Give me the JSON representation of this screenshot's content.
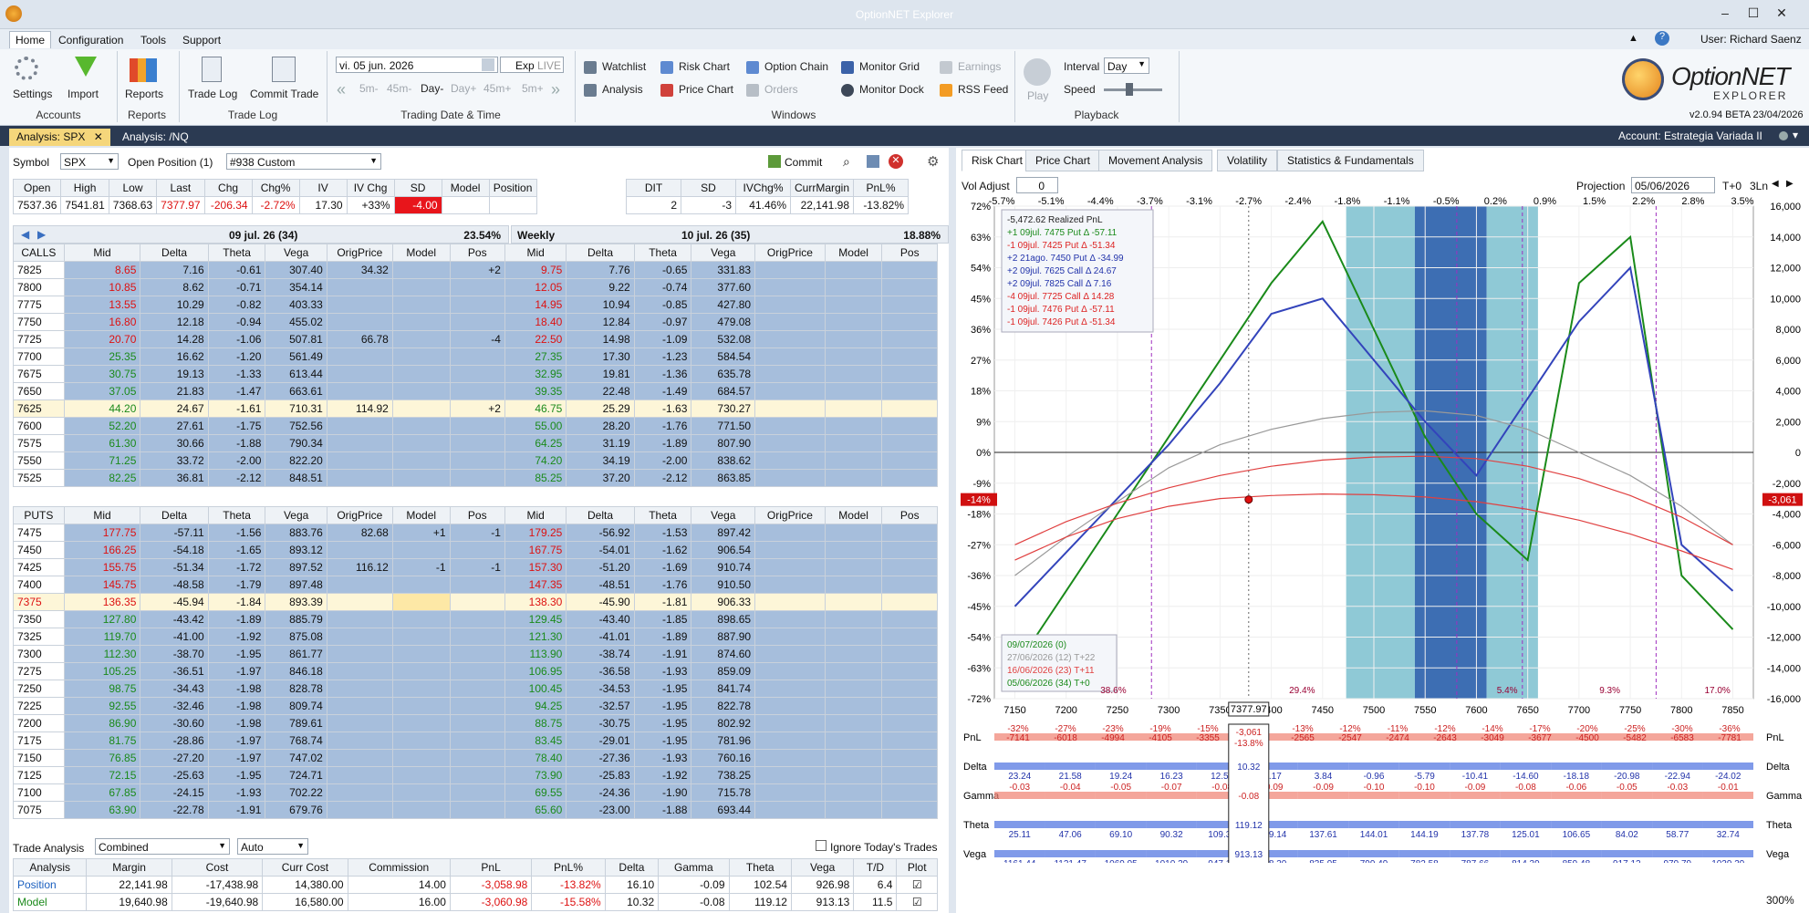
{
  "app": {
    "title": "OptionNET Explorer",
    "user": "User: Richard Saenz",
    "version": "v2.0.94 BETA 23/04/2026",
    "brand_top": "OptionNET",
    "brand_bottom": "EXPLORER"
  },
  "menu": [
    "Home",
    "Configuration",
    "Tools",
    "Support"
  ],
  "ribbon": {
    "settings": "Settings",
    "import": "Import",
    "reports": "Reports",
    "trade_log": "Trade Log",
    "commit_trade": "Commit Trade",
    "g_accounts": "Accounts",
    "g_reports": "Reports",
    "g_tradelog": "Trade Log",
    "g_date": "Trading Date & Time",
    "g_windows": "Windows",
    "g_playback": "Playback",
    "date": "vi. 05 jun. 2026",
    "exp": "Exp",
    "live": "LIVE",
    "steps": [
      "5m-",
      "45m-",
      "Day-",
      "Day+",
      "45m+",
      "5m+"
    ],
    "watchlist": "Watchlist",
    "risk_chart": "Risk Chart",
    "option_chain": "Option Chain",
    "monitor_grid": "Monitor Grid",
    "earnings": "Earnings",
    "analysis": "Analysis",
    "price_chart": "Price Chart",
    "orders": "Orders",
    "monitor_dock": "Monitor Dock",
    "rss_feed": "RSS Feed",
    "play": "Play",
    "interval_label": "Interval",
    "interval": "Day",
    "speed_label": "Speed"
  },
  "doctabs": [
    "Analysis: SPX",
    "Analysis: /NQ"
  ],
  "account": "Account: Estrategia Variada II",
  "symbol_bar": {
    "symbol_label": "Symbol",
    "symbol": "SPX",
    "open_pos": "Open Position (1)",
    "custom": "#938 Custom",
    "commit": "Commit"
  },
  "quote": {
    "headers": [
      "Open",
      "High",
      "Low",
      "Last",
      "Chg",
      "Chg%",
      "IV",
      "IV Chg",
      "SD",
      "Model",
      "Position"
    ],
    "values": [
      "7537.36",
      "7541.81",
      "7368.63",
      "7377.97",
      "-206.34",
      "-2.72%",
      "17.30",
      "+33%",
      "-4.00",
      "",
      ""
    ]
  },
  "stats": {
    "headers": [
      "DIT",
      "SD",
      "IVChg%",
      "CurrMargin",
      "PnL%"
    ],
    "values": [
      "2",
      "-3",
      "41.46%",
      "22,141.98",
      "-13.82%"
    ]
  },
  "exp1": {
    "label": "09 jul. 26 (34)",
    "iv": "23.54%"
  },
  "exp2": {
    "label": "Weekly",
    "date": "10 jul. 26 (35)",
    "iv": "18.88%"
  },
  "chain_headers": [
    "Mid",
    "Delta",
    "Theta",
    "Vega",
    "OrigPrice",
    "Model",
    "Pos"
  ],
  "chain_headers2": [
    "Mid",
    "Delta",
    "Theta",
    "Vega",
    "OrigPrice",
    "Model",
    "Pos"
  ],
  "calls": {
    "label": "CALLS",
    "rows": [
      [
        "7825",
        "8.65",
        "7.16",
        "-0.61",
        "307.40",
        "34.32",
        "",
        "+2",
        "9.75",
        "7.76",
        "-0.65",
        "331.83"
      ],
      [
        "7800",
        "10.85",
        "8.62",
        "-0.71",
        "354.14",
        "",
        "",
        "",
        "12.05",
        "9.22",
        "-0.74",
        "377.60"
      ],
      [
        "7775",
        "13.55",
        "10.29",
        "-0.82",
        "403.33",
        "",
        "",
        "",
        "14.95",
        "10.94",
        "-0.85",
        "427.80"
      ],
      [
        "7750",
        "16.80",
        "12.18",
        "-0.94",
        "455.02",
        "",
        "",
        "",
        "18.40",
        "12.84",
        "-0.97",
        "479.08"
      ],
      [
        "7725",
        "20.70",
        "14.28",
        "-1.06",
        "507.81",
        "66.78",
        "",
        "-4",
        "22.50",
        "14.98",
        "-1.09",
        "532.08"
      ],
      [
        "7700",
        "25.35",
        "16.62",
        "-1.20",
        "561.49",
        "",
        "",
        "",
        "27.35",
        "17.30",
        "-1.23",
        "584.54"
      ],
      [
        "7675",
        "30.75",
        "19.13",
        "-1.33",
        "613.44",
        "",
        "",
        "",
        "32.95",
        "19.81",
        "-1.36",
        "635.78"
      ],
      [
        "7650",
        "37.05",
        "21.83",
        "-1.47",
        "663.61",
        "",
        "",
        "",
        "39.35",
        "22.48",
        "-1.49",
        "684.57"
      ],
      [
        "7625",
        "44.20",
        "24.67",
        "-1.61",
        "710.31",
        "114.92",
        "",
        "+2",
        "46.75",
        "25.29",
        "-1.63",
        "730.27"
      ],
      [
        "7600",
        "52.20",
        "27.61",
        "-1.75",
        "752.56",
        "",
        "",
        "",
        "55.00",
        "28.20",
        "-1.76",
        "771.50"
      ],
      [
        "7575",
        "61.30",
        "30.66",
        "-1.88",
        "790.34",
        "",
        "",
        "",
        "64.25",
        "31.19",
        "-1.89",
        "807.90"
      ],
      [
        "7550",
        "71.25",
        "33.72",
        "-2.00",
        "822.20",
        "",
        "",
        "",
        "74.20",
        "34.19",
        "-2.00",
        "838.62"
      ],
      [
        "7525",
        "82.25",
        "36.81",
        "-2.12",
        "848.51",
        "",
        "",
        "",
        "85.25",
        "37.20",
        "-2.12",
        "863.85"
      ]
    ]
  },
  "puts": {
    "label": "PUTS",
    "rows": [
      [
        "7475",
        "177.75",
        "-57.11",
        "-1.56",
        "883.76",
        "82.68",
        "+1",
        "-1",
        "179.25",
        "-56.92",
        "-1.53",
        "897.42"
      ],
      [
        "7450",
        "166.25",
        "-54.18",
        "-1.65",
        "893.12",
        "",
        "",
        "",
        "167.75",
        "-54.01",
        "-1.62",
        "906.54"
      ],
      [
        "7425",
        "155.75",
        "-51.34",
        "-1.72",
        "897.52",
        "116.12",
        "-1",
        "-1",
        "157.30",
        "-51.20",
        "-1.69",
        "910.74"
      ],
      [
        "7400",
        "145.75",
        "-48.58",
        "-1.79",
        "897.48",
        "",
        "",
        "",
        "147.35",
        "-48.51",
        "-1.76",
        "910.50"
      ],
      [
        "7375",
        "136.35",
        "-45.94",
        "-1.84",
        "893.39",
        "",
        "",
        "",
        "138.30",
        "-45.90",
        "-1.81",
        "906.33"
      ],
      [
        "7350",
        "127.80",
        "-43.42",
        "-1.89",
        "885.79",
        "",
        "",
        "",
        "129.45",
        "-43.40",
        "-1.85",
        "898.65"
      ],
      [
        "7325",
        "119.70",
        "-41.00",
        "-1.92",
        "875.08",
        "",
        "",
        "",
        "121.30",
        "-41.01",
        "-1.89",
        "887.90"
      ],
      [
        "7300",
        "112.30",
        "-38.70",
        "-1.95",
        "861.77",
        "",
        "",
        "",
        "113.90",
        "-38.74",
        "-1.91",
        "874.60"
      ],
      [
        "7275",
        "105.25",
        "-36.51",
        "-1.97",
        "846.18",
        "",
        "",
        "",
        "106.95",
        "-36.58",
        "-1.93",
        "859.09"
      ],
      [
        "7250",
        "98.75",
        "-34.43",
        "-1.98",
        "828.78",
        "",
        "",
        "",
        "100.45",
        "-34.53",
        "-1.95",
        "841.74"
      ],
      [
        "7225",
        "92.55",
        "-32.46",
        "-1.98",
        "809.74",
        "",
        "",
        "",
        "94.25",
        "-32.57",
        "-1.95",
        "822.78"
      ],
      [
        "7200",
        "86.90",
        "-30.60",
        "-1.98",
        "789.61",
        "",
        "",
        "",
        "88.75",
        "-30.75",
        "-1.95",
        "802.92"
      ],
      [
        "7175",
        "81.75",
        "-28.86",
        "-1.97",
        "768.74",
        "",
        "",
        "",
        "83.45",
        "-29.01",
        "-1.95",
        "781.96"
      ],
      [
        "7150",
        "76.85",
        "-27.20",
        "-1.97",
        "747.02",
        "",
        "",
        "",
        "78.40",
        "-27.36",
        "-1.93",
        "760.16"
      ],
      [
        "7125",
        "72.15",
        "-25.63",
        "-1.95",
        "724.71",
        "",
        "",
        "",
        "73.90",
        "-25.83",
        "-1.92",
        "738.25"
      ],
      [
        "7100",
        "67.85",
        "-24.15",
        "-1.93",
        "702.22",
        "",
        "",
        "",
        "69.55",
        "-24.36",
        "-1.90",
        "715.78"
      ],
      [
        "7075",
        "63.90",
        "-22.78",
        "-1.91",
        "679.76",
        "",
        "",
        "",
        "65.60",
        "-23.00",
        "-1.88",
        "693.44"
      ]
    ]
  },
  "trade_analysis": {
    "label": "Trade Analysis",
    "mode": "Combined",
    "auto": "Auto",
    "ignore": "Ignore Today's Trades",
    "headers": [
      "Analysis",
      "Margin",
      "Cost",
      "Curr Cost",
      "Commission",
      "PnL",
      "PnL%",
      "Delta",
      "Gamma",
      "Theta",
      "Vega",
      "T/D",
      "Plot"
    ],
    "rows": [
      [
        "Position",
        "22,141.98",
        "-17,438.98",
        "14,380.00",
        "14.00",
        "-3,058.98",
        "-13.82%",
        "16.10",
        "-0.09",
        "102.54",
        "926.98",
        "6.4"
      ],
      [
        "Model",
        "19,640.98",
        "-19,640.98",
        "16,580.00",
        "16.00",
        "-3,060.98",
        "-15.58%",
        "10.32",
        "-0.08",
        "119.12",
        "913.13",
        "11.5"
      ]
    ]
  },
  "right_tabs": [
    "Risk Chart",
    "Price Chart",
    "Movement Analysis",
    "Volatility",
    "Statistics & Fundamentals"
  ],
  "risk": {
    "vol_adjust_label": "Vol Adjust",
    "vol_adjust": "0",
    "projection_label": "Projection",
    "projection": "05/06/2026",
    "t0": "T+0",
    "ln": "3Ln",
    "pct_top": [
      "-5.7%",
      "-5.1%",
      "-4.4%",
      "-3.7%",
      "-3.1%",
      "-2.7%",
      "-2.4%",
      "-1.8%",
      "-1.1%",
      "-0.5%",
      "0.2%",
      "0.9%",
      "1.5%",
      "2.2%",
      "2.8%",
      "3.5%"
    ],
    "legend": [
      "-5,472.62 Realized PnL",
      "+1 09jul. 7475 Put Δ -57.11",
      "-1 09jul. 7425 Put Δ -51.34",
      "+2 21ago. 7450 Put Δ -34.99",
      "+2 09jul. 7625 Call Δ 24.67",
      "+2 09jul. 7825 Call Δ 7.16",
      "-4 09jul. 7725 Call Δ 14.28",
      "-1 09jul. 7476 Put Δ -57.11",
      "-1 09jul. 7426 Put Δ -51.34"
    ],
    "dates": [
      "09/07/2026 (0)",
      "27/06/2026 (12) T+22",
      "16/06/2026 (23) T+11",
      "05/06/2026 (34) T+0"
    ],
    "badge_left": "-14%",
    "badge_right": "-3,061",
    "price_box": "7377.97",
    "zoom": "300%",
    "zone_labels": [
      "38.6%",
      "29.4%",
      "5.4%",
      "9.3%",
      "17.0%"
    ],
    "vlabels": [
      "7283.19",
      "7580.85",
      "7644.81",
      "7775.18",
      "7481.25",
      "7532.78",
      "7735.84",
      "7687.37"
    ]
  },
  "chart_data": {
    "type": "line",
    "x": [
      7150,
      7200,
      7250,
      7300,
      7350,
      7400,
      7450,
      7500,
      7550,
      7600,
      7650,
      7700,
      7750,
      7800,
      7850
    ],
    "xlim": [
      7130,
      7870
    ],
    "y_left_lim": [
      -72,
      72
    ],
    "y_right_lim": [
      -16000,
      16000
    ],
    "y_left_ticks": [
      "72%",
      "63%",
      "54%",
      "45%",
      "36%",
      "27%",
      "18%",
      "9%",
      "0%",
      "-9%",
      "-18%",
      "-27%",
      "-36%",
      "-45%",
      "-54%",
      "-63%",
      "-72%"
    ],
    "y_right_ticks": [
      "16,000",
      "14,000",
      "12,000",
      "10,000",
      "8,000",
      "6,000",
      "4,000",
      "2,000",
      "0",
      "-2,000",
      "-4,000",
      "-6,000",
      "-8,000",
      "-10,000",
      "-12,000",
      "-14,000",
      "-16,000"
    ],
    "series": [
      {
        "name": "09/07/2026 (0)",
        "color": "#1a8a1a",
        "values": [
          -14000,
          -9000,
          -4000,
          1000,
          6000,
          11000,
          15000,
          8000,
          1000,
          -4000,
          -7000,
          11000,
          14000,
          -8000,
          -11500
        ]
      },
      {
        "name": "Model",
        "color": "#3344bb",
        "values": [
          -10000,
          -6500,
          -3000,
          500,
          4500,
          9000,
          10000,
          6000,
          2000,
          -1500,
          3500,
          8500,
          12000,
          -6000,
          -9000
        ]
      },
      {
        "name": "27/06/2026 (12) T+22",
        "color": "#999999",
        "values": [
          -8000,
          -5500,
          -3200,
          -1000,
          500,
          1500,
          2200,
          2600,
          2700,
          2400,
          1500,
          0,
          -1500,
          -3500,
          -6000
        ]
      },
      {
        "name": "16/06/2026 (23) T+11",
        "color": "#e04040",
        "values": [
          -6000,
          -4500,
          -3300,
          -2300,
          -1500,
          -900,
          -500,
          -300,
          -250,
          -400,
          -900,
          -1700,
          -2800,
          -4200,
          -6000
        ]
      },
      {
        "name": "05/06/2026 (34) T+0",
        "color": "#e04040",
        "values": [
          -7000,
          -5500,
          -4300,
          -3500,
          -3000,
          -2800,
          -2700,
          -2750,
          -2900,
          -3200,
          -3700,
          -4400,
          -5300,
          -6400,
          -7600
        ]
      }
    ]
  },
  "stripes": {
    "row_labels": [
      "PnL",
      "Delta",
      "Gamma",
      "Theta",
      "Vega"
    ],
    "pnl_pct": [
      "-32%",
      "-27%",
      "-23%",
      "-19%",
      "-15%",
      "-14%",
      "-13%",
      "-12%",
      "-11%",
      "-12%",
      "-14%",
      "-17%",
      "-20%",
      "-25%",
      "-30%",
      "-36%"
    ],
    "pnl": [
      "-7141",
      "-6018",
      "-4994",
      "-4105",
      "-3355",
      "-2947",
      "-2565",
      "-2547",
      "-2474",
      "-2643",
      "-3049",
      "-3677",
      "-4500",
      "-5482",
      "-6583",
      "-7781"
    ],
    "delta": [
      "23.24",
      "21.58",
      "19.24",
      "16.23",
      "12.55",
      "8.17",
      "3.84",
      "-0.96",
      "-5.79",
      "-10.41",
      "-14.60",
      "-18.18",
      "-20.98",
      "-22.94",
      "-24.02"
    ],
    "gamma": [
      "-0.03",
      "-0.04",
      "-0.05",
      "-0.07",
      "-0.08",
      "-0.09",
      "-0.09",
      "-0.10",
      "-0.10",
      "-0.09",
      "-0.08",
      "-0.06",
      "-0.05",
      "-0.03",
      "-0.01"
    ],
    "theta": [
      "25.11",
      "47.06",
      "69.10",
      "90.32",
      "109.34",
      "129.14",
      "137.61",
      "144.01",
      "144.19",
      "137.78",
      "125.01",
      "106.65",
      "84.02",
      "58.77",
      "32.74"
    ],
    "vega": [
      "1161.44",
      "1121.47",
      "1069.95",
      "1010.39",
      "947.17",
      "888.30",
      "835.95",
      "799.49",
      "782.58",
      "787.66",
      "814.39",
      "859.48",
      "917.12",
      "979.79",
      "1039.39"
    ],
    "center": {
      "pnl": "-3,061",
      "pnl_pct": "-13.8%",
      "delta": "10.32",
      "gamma": "-0.08",
      "theta": "119.12",
      "vega": "913.13"
    }
  }
}
